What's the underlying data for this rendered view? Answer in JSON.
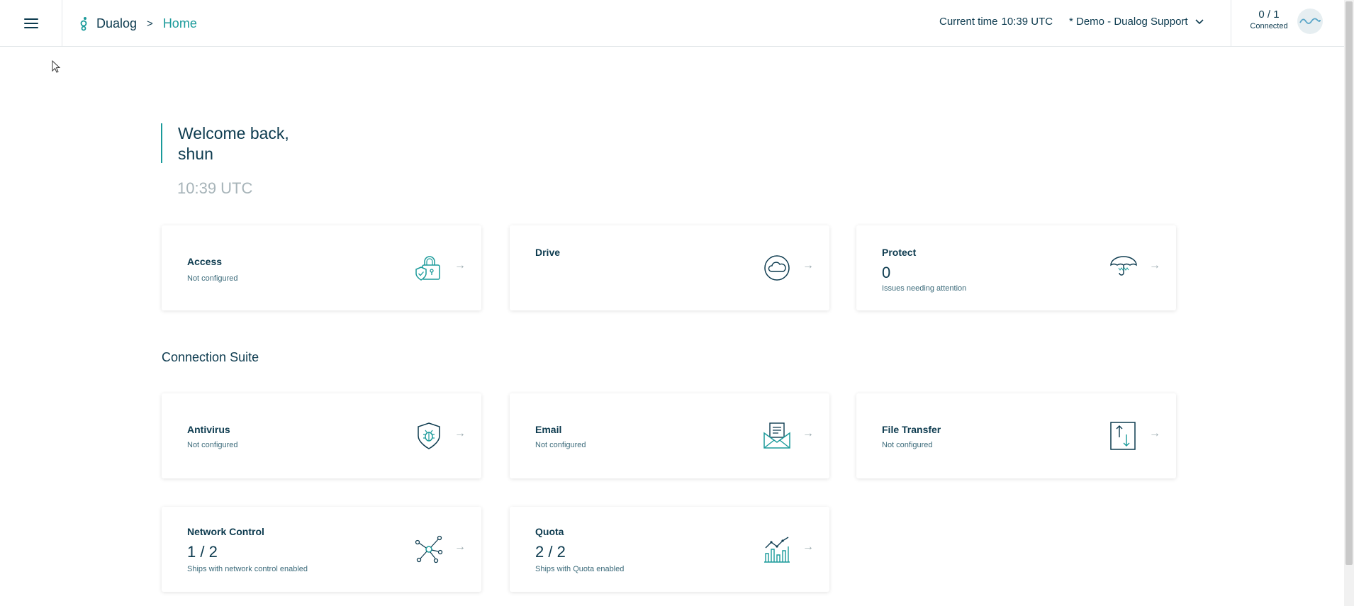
{
  "header": {
    "brand": "Dualog",
    "breadcrumb_sep": ">",
    "breadcrumb_current": "Home",
    "current_time_label": "Current time",
    "current_time_value": "10:39 UTC",
    "org_selected": "* Demo - Dualog Support",
    "connected_count": "0 / 1",
    "connected_label": "Connected"
  },
  "welcome": {
    "line1": "Welcome back,",
    "line2": "shun",
    "clock": "10:39 UTC"
  },
  "cards_top": [
    {
      "title": "Access",
      "sub": "Not configured",
      "icon": "lock-shield-icon"
    },
    {
      "title": "Drive",
      "icon": "cloud-icon"
    },
    {
      "title": "Protect",
      "value": "0",
      "sub": "Issues needing attention",
      "icon": "umbrella-icon"
    }
  ],
  "section": {
    "title": "Connection Suite"
  },
  "cards_suite": [
    {
      "title": "Antivirus",
      "sub": "Not configured",
      "icon": "shield-bug-icon"
    },
    {
      "title": "Email",
      "sub": "Not configured",
      "icon": "envelope-icon"
    },
    {
      "title": "File Transfer",
      "sub": "Not configured",
      "icon": "file-transfer-icon"
    },
    {
      "title": "Network Control",
      "value": "1 / 2",
      "sub": "Ships with network control enabled",
      "icon": "network-icon"
    },
    {
      "title": "Quota",
      "value": "2 / 2",
      "sub": "Ships with Quota enabled",
      "icon": "chart-icon"
    }
  ],
  "arrow_glyph": "→",
  "colors": {
    "accent": "#1a9a9a",
    "text": "#0d3b4f",
    "muted": "#a7b4b9"
  }
}
